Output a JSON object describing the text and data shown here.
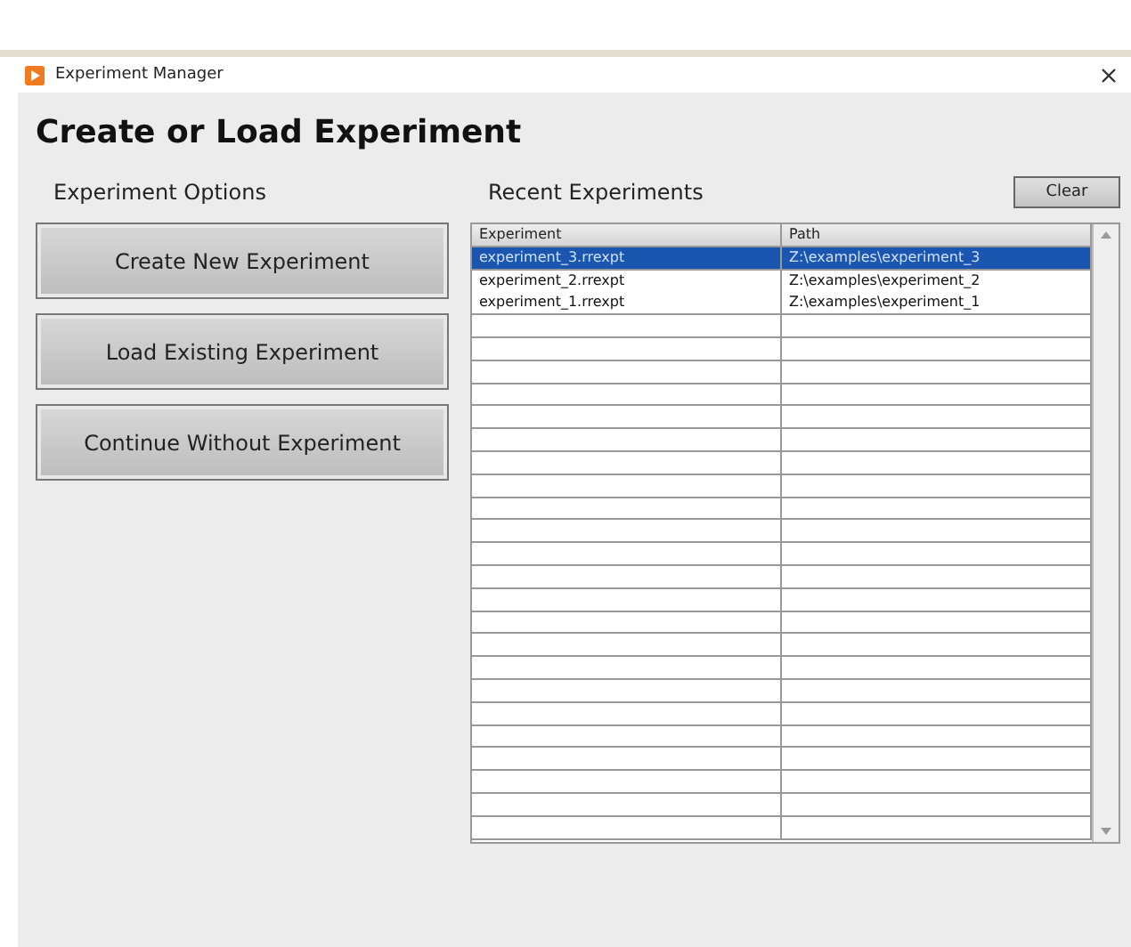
{
  "window": {
    "title": "Experiment Manager"
  },
  "heading": "Create or Load Experiment",
  "options": {
    "title": "Experiment Options",
    "buttons": [
      "Create New Experiment",
      "Load Existing Experiment",
      "Continue Without Experiment"
    ]
  },
  "recent": {
    "title": "Recent Experiments",
    "clear_button": "Clear",
    "table": {
      "columns": [
        "Experiment",
        "Path"
      ],
      "rows": [
        {
          "experiment": "experiment_3.rrexpt",
          "path": "Z:\\examples\\experiment_3",
          "selected": true
        },
        {
          "experiment": "experiment_2.rrexpt",
          "path": "Z:\\examples\\experiment_2",
          "selected": false
        },
        {
          "experiment": "experiment_1.rrexpt",
          "path": "Z:\\examples\\experiment_1",
          "selected": false
        }
      ]
    }
  }
}
